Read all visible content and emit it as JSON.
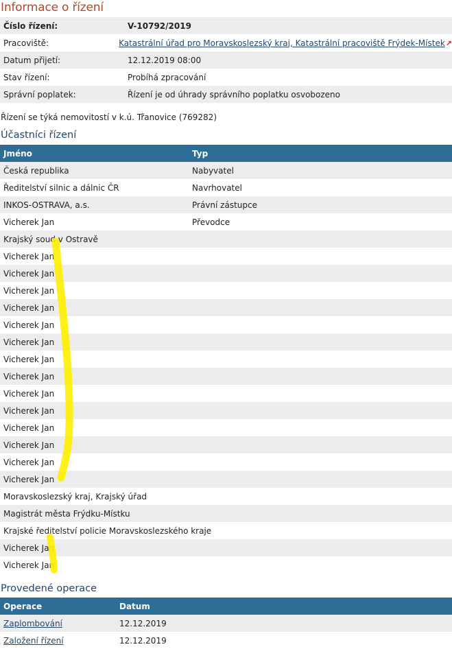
{
  "page_title": "Informace o řízení",
  "info": [
    {
      "label": "Číslo řízení:",
      "value": "V-10792/2019",
      "bold": true
    },
    {
      "label": "Pracoviště:",
      "value": "Katastrální úřad pro Moravskoslezský kraj, Katastrální pracoviště Frýdek-Místek",
      "link": true
    },
    {
      "label": "Datum přijetí:",
      "value": "12.12.2019 08:00"
    },
    {
      "label": "Stav řízení:",
      "value": "Probíhá zpracování"
    },
    {
      "label": "Správní poplatek:",
      "value": "Řízení je od úhrady správního poplatku osvobozeno"
    }
  ],
  "note": "Řízení se týká nemovitostí v k.ú. Třanovice (769282)",
  "participants": {
    "title": "Účastníci řízení",
    "headers": [
      "Jméno",
      "Typ"
    ],
    "rows": [
      [
        "Česká republika",
        "Nabyvatel"
      ],
      [
        "Ředitelství silnic a dálnic ČR",
        "Navrhovatel"
      ],
      [
        "INKOS-OSTRAVA, a.s.",
        "Právní zástupce"
      ],
      [
        "Vicherek Jan",
        "Převodce"
      ],
      [
        "Krajský soud v Ostravě",
        ""
      ],
      [
        "Vicherek Jan",
        ""
      ],
      [
        "Vicherek Jan",
        ""
      ],
      [
        "Vicherek Jan",
        ""
      ],
      [
        "Vicherek Jan",
        ""
      ],
      [
        "Vicherek Jan",
        ""
      ],
      [
        "Vicherek Jan",
        ""
      ],
      [
        "Vicherek Jan",
        ""
      ],
      [
        "Vicherek Jan",
        ""
      ],
      [
        "Vicherek Jan",
        ""
      ],
      [
        "Vicherek Jan",
        ""
      ],
      [
        "Vicherek Jan",
        ""
      ],
      [
        "Vicherek Jan",
        ""
      ],
      [
        "Vicherek Jan",
        ""
      ],
      [
        "Vicherek Jan",
        ""
      ],
      [
        "Moravskoslezský kraj, Krajský úřad",
        ""
      ],
      [
        "Magistrát města Frýdku-Místku",
        ""
      ],
      [
        "Krajské ředitelství policie Moravskoslezského kraje",
        ""
      ],
      [
        "Vicherek Jan",
        ""
      ],
      [
        "Vicherek Jan",
        ""
      ]
    ]
  },
  "operations": {
    "title": "Provedené operace",
    "headers": [
      "Operace",
      "Datum"
    ],
    "rows": [
      [
        "Zaplombování",
        "12.12.2019"
      ],
      [
        "Založení řízení",
        "12.12.2019"
      ]
    ]
  },
  "colors": {
    "title": "#b0472a",
    "section_title": "#23476b",
    "table_header": "#2e6e96",
    "row_stripe": "#ececec",
    "highlight": "#ffee00"
  },
  "icons": {
    "external_link": "external-link-icon"
  }
}
